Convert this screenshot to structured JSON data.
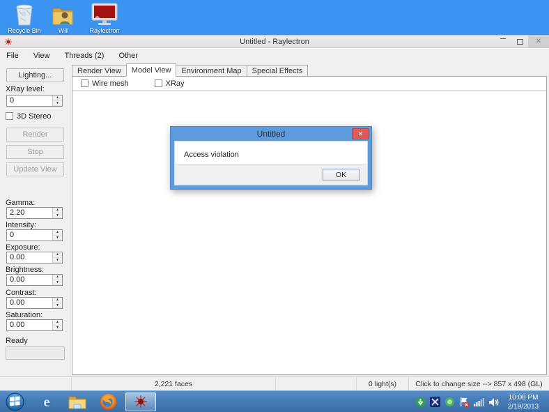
{
  "glyphs": {
    "minimize": "–",
    "close": "✕",
    "spin_up": "▲",
    "spin_down": "▼",
    "ie_letter": "e"
  },
  "colors": {
    "desktop": "#3b93f2",
    "taskbar": "#4a81bc",
    "window_chrome": "#f0f0f0",
    "dialog_blue": "#5e9bdd",
    "close_red": "#dd5b56"
  },
  "desktop": {
    "icons": [
      {
        "label": "Recycle Bin"
      },
      {
        "label": "Will"
      },
      {
        "label": "Raylectron"
      }
    ]
  },
  "window": {
    "title": "Untitled - Raylectron",
    "menu": [
      {
        "label": "File"
      },
      {
        "label": "View"
      },
      {
        "label": "Threads (2)"
      },
      {
        "label": "Other"
      }
    ]
  },
  "sidebar": {
    "lighting_button": "Lighting...",
    "xray_label": "XRay level:",
    "xray_value": "0",
    "stereo_checkbox": "3D Stereo",
    "render_button": "Render",
    "stop_button": "Stop",
    "update_button": "Update View",
    "fields": [
      {
        "label": "Gamma:",
        "value": "2.20"
      },
      {
        "label": "Intensity:",
        "value": "0"
      },
      {
        "label": "Exposure:",
        "value": "0.00"
      },
      {
        "label": "Brightness:",
        "value": "0.00"
      },
      {
        "label": "Contrast:",
        "value": "0.00"
      },
      {
        "label": "Saturation:",
        "value": "0.00"
      }
    ],
    "status": "Ready"
  },
  "tabs": [
    {
      "label": "Render View",
      "active": false
    },
    {
      "label": "Model View",
      "active": true
    },
    {
      "label": "Environment Map",
      "active": false
    },
    {
      "label": "Special Effects",
      "active": false
    }
  ],
  "panel": {
    "checkboxes": [
      {
        "label": "Wire mesh"
      },
      {
        "label": "XRay"
      }
    ]
  },
  "dialog": {
    "title": "Untitled",
    "message": "Access violation",
    "ok_label": "OK"
  },
  "statusbar": {
    "faces": "2,221 faces",
    "lights": "0 light(s)",
    "size_hint": "Click to change size --> 857 x 498 (GL)"
  },
  "taskbar": {
    "time": "10:08 PM",
    "date": "2/19/2013"
  },
  "icon_names": [
    "recycle-bin-icon",
    "user-folder-icon",
    "raylectron-monitor-icon",
    "raylectron-logo-icon",
    "start-icon",
    "internet-explorer-icon",
    "file-explorer-icon",
    "firefox-icon",
    "download-manager-icon",
    "grid-tray-icon",
    "green-utility-icon",
    "action-center-flag-icon",
    "network-icon",
    "volume-icon"
  ]
}
